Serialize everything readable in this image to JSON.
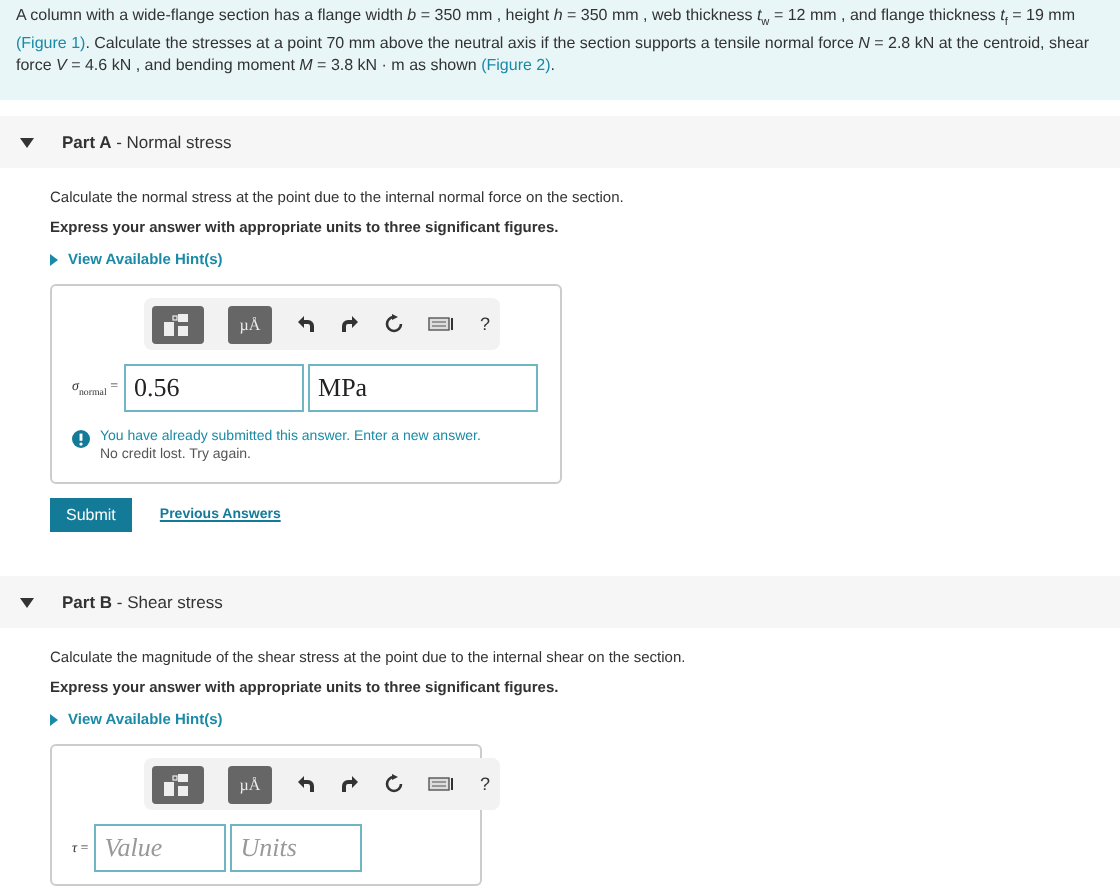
{
  "intro": [
    {
      "kind": "text",
      "text": "A column with a wide-flange section has a flange width *b* = 350 mm , height *h* = 350 mm , web thickness *t*$_{w}$ = 12 mm , and flange thickness *t*$_{f}$ = 19 mm"
    },
    {
      "kind": "link",
      "text": "(Figure 1)"
    },
    {
      "kind": "text",
      "text": ". Calculate the stresses at a point 70 mm above the neutral axis if the section supports a tensile normal force *N* = 2.8 kN at the centroid, shear force *V* = 4.6 kN , and bending moment *M* = 3.8 kN · m as shown"
    },
    {
      "kind": "link",
      "text": "(Figure 2)"
    },
    {
      "kind": "text",
      "text": "."
    }
  ],
  "parts": [
    {
      "heading": "**Part A** - Normal stress",
      "expanded": true,
      "instruction": "Calculate the normal stress at the point due to the internal normal force on the section.",
      "emphasis": "Express your answer with appropriate units to three significant figures.",
      "hint": "View Available Hint(s)",
      "toolbar": {
        "units_button": "µÅ",
        "help": "?"
      },
      "answer": {
        "symbol": "*σ*$_{normal}$ =",
        "value": {
          "value": "0.56"
        },
        "unit": {
          "value": "MPa"
        }
      },
      "feedback": {
        "message": "You have already submitted this answer. Enter a new answer.",
        "note": "No credit lost. Try again."
      },
      "submit": "Submit",
      "previous": "Previous Answers"
    },
    {
      "heading": "**Part B** - Shear stress",
      "expanded": true,
      "instruction": "Calculate the magnitude of the shear stress at the point due to the internal shear on the section.",
      "emphasis": "Express your answer with appropriate units to three significant figures.",
      "hint": "View Available Hint(s)",
      "toolbar": {
        "units_button": "µÅ",
        "help": "?"
      },
      "answer": {
        "symbol": "*τ* =",
        "value": {
          "placeholder": "Value"
        },
        "unit": {
          "placeholder": "Units"
        }
      }
    }
  ]
}
